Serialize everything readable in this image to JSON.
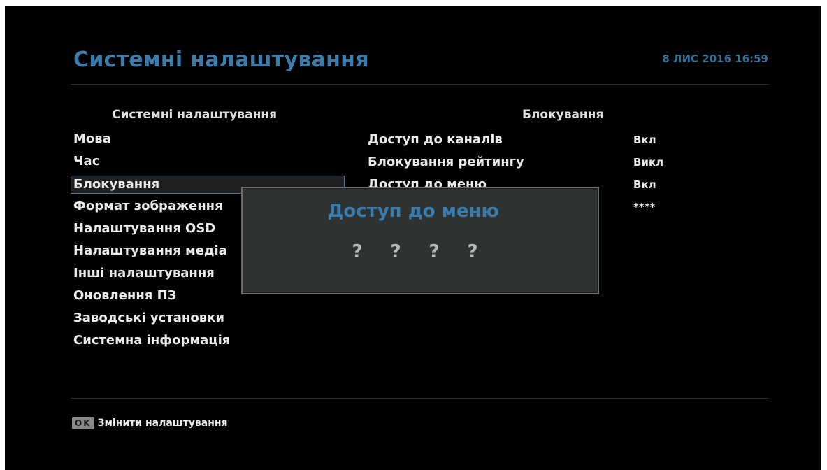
{
  "header": {
    "title": "Системні налаштування",
    "datetime": "8 ЛИС 2016 16:59"
  },
  "left_panel": {
    "header": "Системні налаштування",
    "items": [
      {
        "label": "Мова"
      },
      {
        "label": "Час"
      },
      {
        "label": "Блокування",
        "selected": true
      },
      {
        "label": "Формат зображення"
      },
      {
        "label": "Налаштування OSD"
      },
      {
        "label": "Налаштування медіа"
      },
      {
        "label": "Інші налаштування"
      },
      {
        "label": "Оновлення ПЗ"
      },
      {
        "label": "Заводські установки"
      },
      {
        "label": "Системна інформація"
      }
    ]
  },
  "right_panel": {
    "header": "Блокування",
    "rows": [
      {
        "label": "Доступ до каналів",
        "value": "Вкл"
      },
      {
        "label": "Блокування рейтингу",
        "value": "Викл"
      },
      {
        "label": "Доступ до меню",
        "value": "Вкл"
      },
      {
        "label": "",
        "value": "****"
      }
    ]
  },
  "popup": {
    "title": "Доступ до меню",
    "pin": [
      "?",
      "?",
      "?",
      "?"
    ]
  },
  "footer": {
    "key": "OK",
    "label": "Змінити налаштування"
  },
  "colors": {
    "accent": "#3a7dad",
    "background": "#000000",
    "popup_bg": "#2e3332",
    "text": "#eaeaea"
  }
}
